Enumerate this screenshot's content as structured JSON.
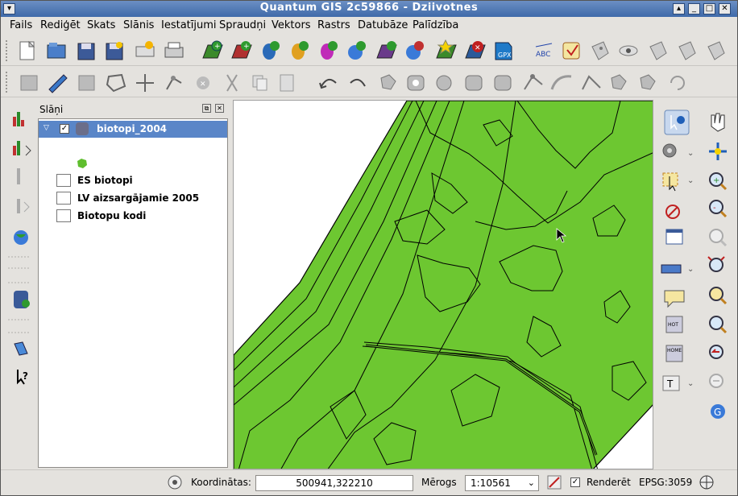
{
  "window": {
    "title": "Quantum GIS 2c59866 - Dziivotnes"
  },
  "menubar": {
    "items": [
      "Fails",
      "Rediģēt",
      "Skats",
      "Slānis",
      "Iestatījumi",
      "Spraudņi",
      "Vektors",
      "Rastrs",
      "Datubāze",
      "Palīdzība"
    ]
  },
  "layers_panel": {
    "title": "Slāņi",
    "layers": [
      {
        "name": "biotopi_2004",
        "checked": true,
        "selected": true,
        "type": "vector",
        "symbol_color": "#5fbe2e"
      },
      {
        "name": "ES biotopi",
        "type": "table"
      },
      {
        "name": "LV aizsargājamie 2005",
        "type": "table"
      },
      {
        "name": "Biotopu kodi",
        "type": "table"
      }
    ]
  },
  "map": {
    "fill_color": "#6dc731",
    "background": "#ffffff"
  },
  "statusbar": {
    "coords_label": "Koordinātas:",
    "coords_value": "500941,322210",
    "scale_label": "Mērogs",
    "scale_value": "1:10561",
    "render_label": "Renderēt",
    "render_checked": true,
    "crs": "EPSG:3059"
  }
}
